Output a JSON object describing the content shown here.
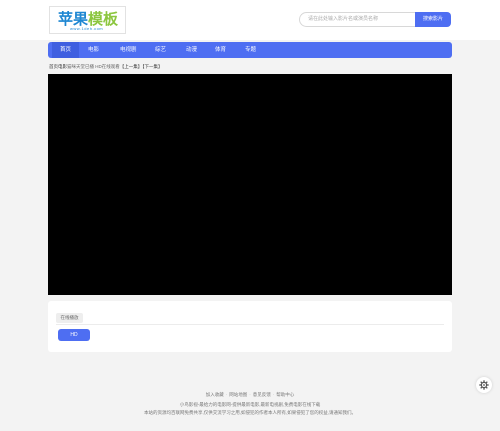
{
  "logo": {
    "main_a": "苹果",
    "main_b": "模板",
    "sub": "www.1deh.com"
  },
  "search": {
    "placeholder": "请在此处输入影片名或演员名称",
    "button": "搜索影片"
  },
  "nav": [
    "首页",
    "电影",
    "电视剧",
    "综艺",
    "动漫",
    "体育",
    "专题"
  ],
  "breadcrumb": {
    "home": "首页",
    "category": "电影",
    "title": "猫咪天堂",
    "path": "已播 HD在线观看",
    "prev": "【上一集】",
    "next": "【下一集】"
  },
  "episodes": {
    "source_tab": "在线播放",
    "items": [
      "HD"
    ]
  },
  "footer": {
    "links": [
      "加入收藏",
      "网站地图",
      "意见反馈",
      "帮助中心"
    ],
    "slogan": "小鸟影视-最给力的电影网-提供最新电影,最新电视剧,免费电影在线下载",
    "disclaimer": "本站的资源均百联网免费共享,仅供交流学习之用,如侵犯的作者本人所有,如果侵犯了您的权益,请通知我们。"
  },
  "colors": {
    "accent": "#4e6ef2",
    "background": "#f3f3f3",
    "player": "#000000"
  },
  "icons": {
    "settings": "gear-icon"
  }
}
